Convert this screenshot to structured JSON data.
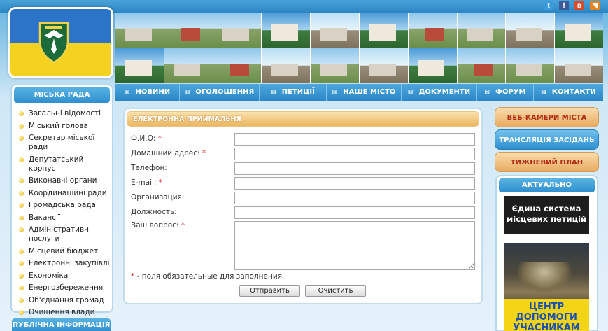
{
  "social": [
    {
      "icon": "twitter-icon",
      "glyph": "t",
      "color": "#3b9ad9"
    },
    {
      "icon": "facebook-icon",
      "glyph": "f",
      "color": "#3a5a98"
    },
    {
      "icon": "vk-icon",
      "glyph": "в",
      "color": "#d94b2b"
    },
    {
      "icon": "rss-icon",
      "glyph": "◥",
      "color": "#e8821e"
    }
  ],
  "sidebar": {
    "title": "МІСЬКА РАДА",
    "items": [
      "Загальні відомості",
      "Міський голова",
      "Секретар міської ради",
      "Депутатський корпус",
      "Виконавчі органи",
      "Координаційні ради",
      "Громадська рада",
      "Вакансії",
      "Адміністративні послуги",
      "Місцевий бюджет",
      "Електронні закупівлі",
      "Економіка",
      "Енергозбереження",
      "Об'єднання громад",
      "Очищення влади"
    ],
    "title2": "ПУБЛІЧНА ІНФОРМАЦІЯ"
  },
  "nav": [
    "НОВИНИ",
    "ОГОЛОШЕННЯ",
    "ПЕТИЦІЇ",
    "НАШЕ МІСТО",
    "ДОКУМЕНТИ",
    "ФОРУМ",
    "КОНТАКТИ"
  ],
  "form": {
    "title": "ЕЛЕКТРОННА ПРИЙМАЛЬНЯ",
    "fields": [
      {
        "label": "Ф.И.О:",
        "required": true
      },
      {
        "label": "Домашний адрес:",
        "required": true
      },
      {
        "label": "Телефон:",
        "required": false
      },
      {
        "label": "E-mail:",
        "required": true
      },
      {
        "label": "Организация:",
        "required": false
      },
      {
        "label": "Должность:",
        "required": false
      }
    ],
    "question_label": "Ваш вопрос:",
    "note": "- поля обязательные для заполнения.",
    "submit": "Отправить",
    "reset": "Очистить"
  },
  "right": {
    "webcams": "ВЕБ-КАМЕРИ МІСТА",
    "broadcast": "ТРАНСЛЯЦІЯ ЗАСІДАНЬ",
    "weekly": "ТИЖНЕВИЙ ПЛАН",
    "actual_title": "АКТУАЛЬНО",
    "banner1": "Єдина система місцевих петицій",
    "banner2": "ЦЕНТР ДОПОМОГИ УЧАСНИКАМ"
  }
}
